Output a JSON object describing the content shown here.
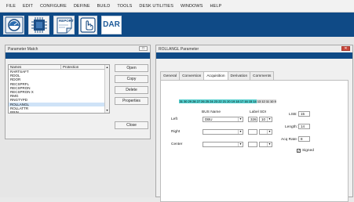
{
  "menu": [
    "FILE",
    "EDIT",
    "CONFIGURE",
    "DEFINE",
    "BUILD",
    "TOOLS",
    "DESK UTILITIES",
    "WINDOWS",
    "HELP"
  ],
  "toolbar": {
    "report_label": "REPORT",
    "dar_label": "DAR",
    "colors": {
      "bar": "#0f4a86",
      "dar_text": "#1d5a99"
    },
    "icons": [
      "monitor-gauge-icon",
      "chip-icon",
      "report-icon",
      "hand-pointer-icon",
      "dar-icon"
    ]
  },
  "param_match": {
    "title": "Parameter Match",
    "columns": [
      "Names",
      "Protection"
    ],
    "rows": [
      "RARTSAFT",
      "RDOL",
      "RDOR",
      "RECSPRFL",
      "RECSPRON",
      "RECSPRON X",
      "RMG",
      "RNGTYPD",
      "ROLLANGL",
      "ROLLATTR",
      "RRIN"
    ],
    "selected_index": 8,
    "buttons": {
      "open": "Open",
      "copy": "Copy",
      "delete": "Delete",
      "properties": "Properties",
      "close": "Close"
    }
  },
  "rollangl": {
    "title": "ROLLANGL Parameter",
    "tabs": [
      "General",
      "Conversion",
      "Acquisition",
      "Derivation",
      "Comments"
    ],
    "active_tab": "Acquisition",
    "bits": [
      {
        "n": "31",
        "hl": true
      },
      {
        "n": "30",
        "hl": true
      },
      {
        "n": "29",
        "hl": true
      },
      {
        "n": "28",
        "hl": true
      },
      {
        "n": "27",
        "hl": true
      },
      {
        "n": "26",
        "hl": true
      },
      {
        "n": "25",
        "hl": true
      },
      {
        "n": "24",
        "hl": true
      },
      {
        "n": "23",
        "hl": true
      },
      {
        "n": "22",
        "hl": true
      },
      {
        "n": "21",
        "hl": true
      },
      {
        "n": "20",
        "hl": true
      },
      {
        "n": "19",
        "hl": true
      },
      {
        "n": "18",
        "hl": true
      },
      {
        "n": "17",
        "hl": true
      },
      {
        "n": "16",
        "hl": true
      },
      {
        "n": "15",
        "hl": true
      },
      {
        "n": "14",
        "hl": true
      },
      {
        "n": "13",
        "hl": false
      },
      {
        "n": "12",
        "hl": false
      },
      {
        "n": "11",
        "hl": false
      },
      {
        "n": "10",
        "hl": false
      },
      {
        "n": "9",
        "hl": false
      }
    ],
    "bit_colors": {
      "highlight": "#55d0cf",
      "plain": "#dadada"
    },
    "headers": {
      "bus_name": "BUS Name",
      "label": "Label",
      "sdi": "SDI"
    },
    "left": {
      "label": "Left",
      "bus": "DBU",
      "label_value": "326",
      "sdi": "10"
    },
    "right": {
      "label": "Right",
      "bus": "",
      "label_value": "",
      "sdi": ""
    },
    "center": {
      "label": "Center",
      "bus": "",
      "label_value": "",
      "sdi": ""
    },
    "lsb": {
      "label": "LSB:",
      "value": "15"
    },
    "length": {
      "label": "Length:",
      "value": "14"
    },
    "acq_rate": {
      "label": "Acq Rate:",
      "value": "8"
    },
    "signed": {
      "label": "Signed",
      "checked": true
    }
  }
}
